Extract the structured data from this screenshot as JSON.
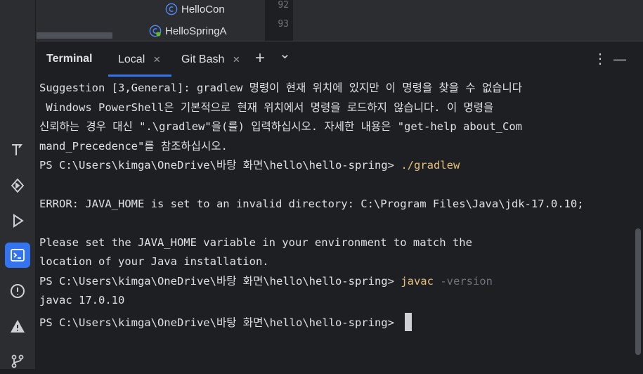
{
  "project_tree": {
    "items": [
      {
        "label": "HelloCon",
        "icon": "class-icon"
      },
      {
        "label": "HelloSpringA",
        "icon": "spring-app-icon"
      }
    ],
    "line_numbers": [
      "92",
      "93"
    ]
  },
  "terminal": {
    "title": "Terminal",
    "tabs": [
      {
        "label": "Local",
        "active": true
      },
      {
        "label": "Git Bash",
        "active": false
      }
    ],
    "close_glyph": "×",
    "add_glyph": "+",
    "dropdown_glyph": "⌄",
    "more_glyph": "⋮",
    "minimize_glyph": "—",
    "lines": {
      "l1": "Suggestion [3,General]: gradlew 명령이 현재 위치에 있지만 이 명령을 찾을 수 없습니다",
      "l2": " Windows PowerShell은 기본적으로 현재 위치에서 명령을 로드하지 않습니다. 이 명령을",
      "l3": "신뢰하는 경우 대신 \".\\gradlew\"을(를) 입력하십시오. 자세한 내용은 \"get-help about_Com",
      "l4": "mand_Precedence\"를 참조하십시오.",
      "prompt": "PS C:\\Users\\kimga\\OneDrive\\바탕 화면\\hello\\hello-spring> ",
      "cmd1": "./gradlew",
      "error": "ERROR: JAVA_HOME is set to an invalid directory: C:\\Program Files\\Java\\jdk-17.0.10;",
      "hint1": "Please set the JAVA_HOME variable in your environment to match the",
      "hint2": "location of your Java installation.",
      "cmd2": "javac",
      "cmd2_arg": " -version",
      "out": "javac 17.0.10"
    }
  },
  "left_toolbar": {
    "icons": [
      "build-icon",
      "services-icon",
      "run-icon",
      "terminal-icon",
      "problems-icon",
      "notifications-icon",
      "git-icon"
    ],
    "active": "terminal-icon"
  },
  "colors": {
    "accent": "#3574f0",
    "command": "#e5c07b",
    "background": "#1e1f22"
  }
}
